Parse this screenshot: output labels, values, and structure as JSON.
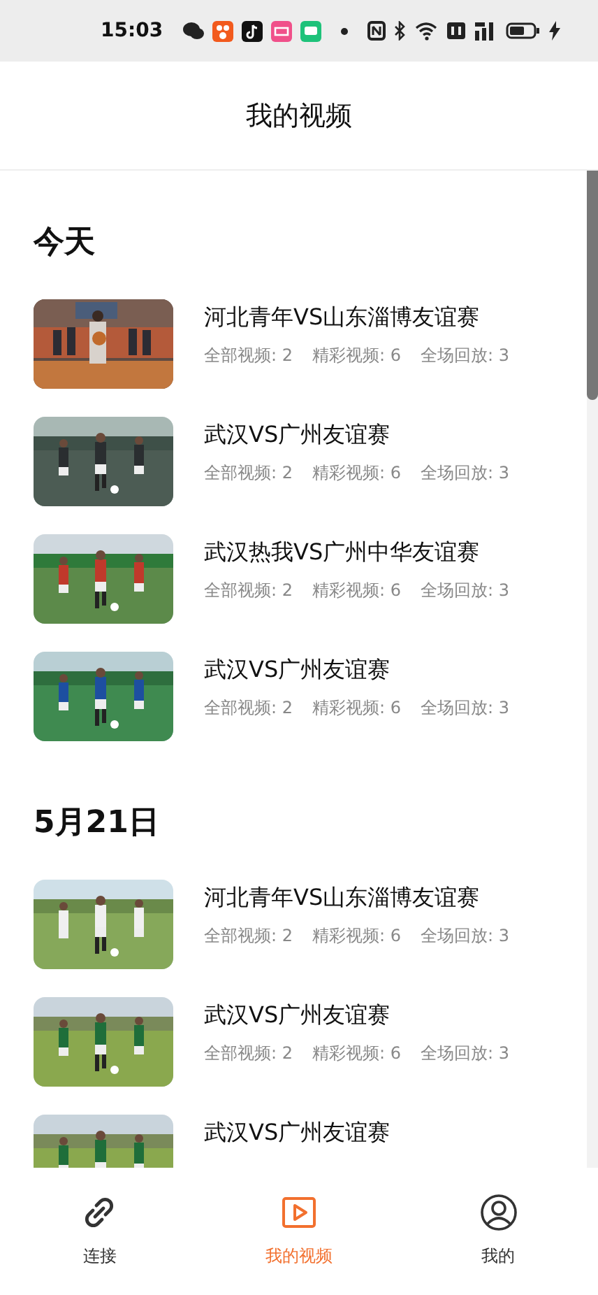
{
  "status_bar": {
    "time": "15:03"
  },
  "header": {
    "title": "我的视频"
  },
  "sections": [
    {
      "heading": "今天",
      "videos": [
        {
          "title": "河北青年VS山东淄博友谊赛",
          "stats": [
            "全部视频: 2",
            "精彩视频: 6",
            "全场回放: 3"
          ]
        },
        {
          "title": "武汉VS广州友谊赛",
          "stats": [
            "全部视频: 2",
            "精彩视频: 6",
            "全场回放: 3"
          ]
        },
        {
          "title": "武汉热我VS广州中华友谊赛",
          "stats": [
            "全部视频: 2",
            "精彩视频: 6",
            "全场回放: 3"
          ]
        },
        {
          "title": "武汉VS广州友谊赛",
          "stats": [
            "全部视频: 2",
            "精彩视频: 6",
            "全场回放: 3"
          ]
        }
      ]
    },
    {
      "heading": "5月21日",
      "videos": [
        {
          "title": "河北青年VS山东淄博友谊赛",
          "stats": [
            "全部视频: 2",
            "精彩视频: 6",
            "全场回放: 3"
          ]
        },
        {
          "title": "武汉VS广州友谊赛",
          "stats": [
            "全部视频: 2",
            "精彩视频: 6",
            "全场回放: 3"
          ]
        },
        {
          "title": "武汉VS广州友谊赛"
        }
      ]
    }
  ],
  "tabs": [
    {
      "label": "连接",
      "selected": false
    },
    {
      "label": "我的视频",
      "selected": true
    },
    {
      "label": "我的",
      "selected": false
    }
  ]
}
